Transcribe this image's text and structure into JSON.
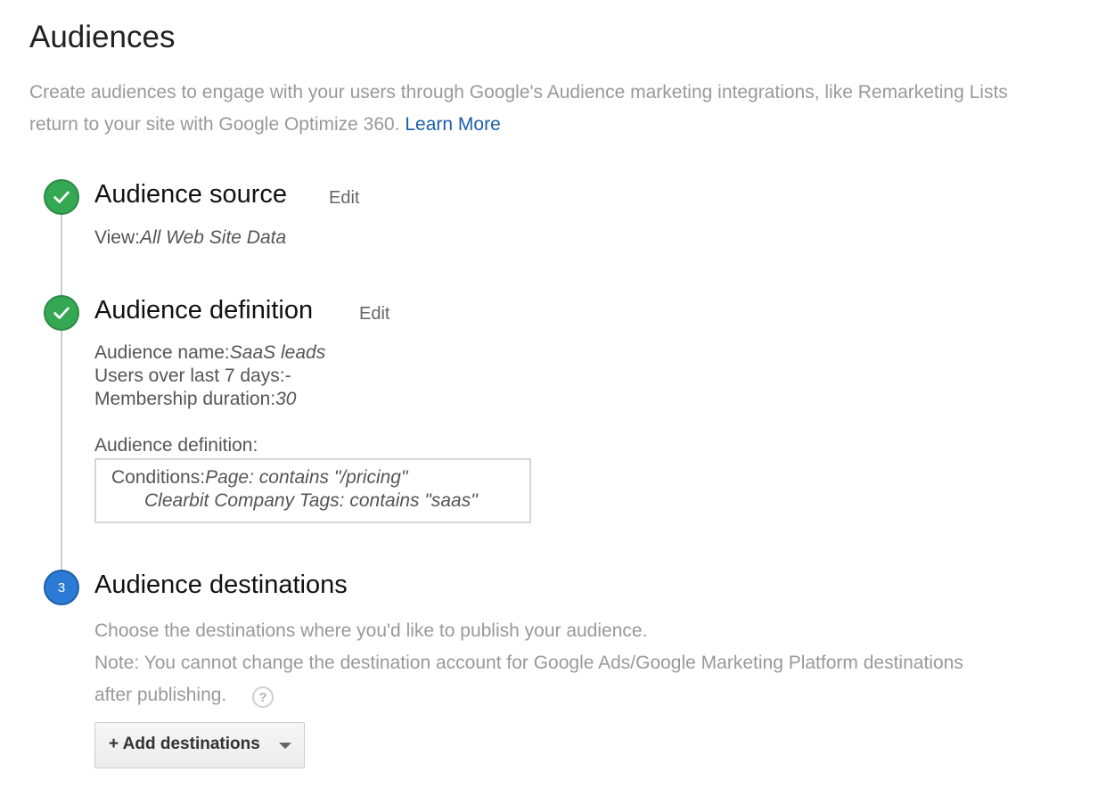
{
  "page": {
    "title": "Audiences",
    "intro_line1": "Create audiences to engage with your users through Google's Audience marketing integrations, like Remarketing Lists",
    "intro_line2": "return to your site with Google Optimize 360.",
    "learn_more": "Learn More"
  },
  "steps": [
    {
      "status": "done",
      "icon": "check-icon",
      "title": "Audience source",
      "edit_label": "Edit",
      "view_label": "View:",
      "view_value": "All Web Site Data"
    },
    {
      "status": "done",
      "icon": "check-icon",
      "title": "Audience definition",
      "edit_label": "Edit",
      "name_label": "Audience name:",
      "name_value": "SaaS leads",
      "users_label": "Users over last 7 days:",
      "users_value": "-",
      "duration_label": "Membership duration:",
      "duration_value": "30",
      "definition_label": "Audience definition:",
      "conditions_label": "Conditions:",
      "condition_1": "Page: contains \"/pricing\"",
      "condition_2": "Clearbit Company Tags: contains \"saas\""
    },
    {
      "status": "current",
      "number": "3",
      "title": "Audience destinations",
      "description": "Choose the destinations where you'd like to publish your audience.",
      "note_line1": "Note: You cannot change the destination account for Google Ads/Google Marketing Platform destinations",
      "note_line2": "after publishing.",
      "help_glyph": "?",
      "add_button_label": "+ Add destinations"
    }
  ],
  "colors": {
    "done_badge": "#34a853",
    "current_badge": "#2b7bd6",
    "link": "#1a5fa8",
    "muted_text": "#999999"
  }
}
